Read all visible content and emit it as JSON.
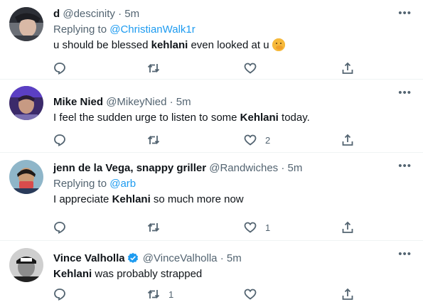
{
  "tweets": [
    {
      "name": "d",
      "handle": "@descinity",
      "sep": "·",
      "time": "5m",
      "replying_prefix": "Replying to",
      "replying_to": "@ChristianWalk1r",
      "text_pre": "u should be blessed ",
      "text_bold": "kehlani",
      "text_post": " even looked at u",
      "emoji": "face-with-hand-over-mouth",
      "counts": {
        "reply": "",
        "retweet": "",
        "like": ""
      }
    },
    {
      "name": "Mike Nied",
      "handle": "@MikeyNied",
      "sep": "·",
      "time": "5m",
      "text_pre": "I feel the sudden urge to listen to some ",
      "text_bold": "Kehlani",
      "text_post": " today.",
      "counts": {
        "reply": "",
        "retweet": "",
        "like": "2"
      }
    },
    {
      "name": "jenn de la Vega, snappy griller",
      "handle": "@Randwiches",
      "sep": "·",
      "time": "5m",
      "replying_prefix": "Replying to",
      "replying_to": "@arb",
      "text_pre": "I appreciate ",
      "text_bold": "Kehlani",
      "text_post": " so much more now",
      "counts": {
        "reply": "",
        "retweet": "",
        "like": "1"
      }
    },
    {
      "name": "Vince Valholla",
      "verified": true,
      "handle": "@VinceValholla",
      "sep": "·",
      "time": "5m",
      "text_pre": "",
      "text_bold": "Kehlani",
      "text_post": " was probably strapped",
      "counts": {
        "reply": "",
        "retweet": "1",
        "like": ""
      }
    }
  ],
  "colors": {
    "text": "#0f1419",
    "secondary": "#536471",
    "link": "#1d9bf0",
    "divider": "#eff3f4"
  },
  "icons": [
    "more-icon",
    "reply-icon",
    "retweet-icon",
    "like-icon",
    "share-icon",
    "verified-badge-icon"
  ]
}
